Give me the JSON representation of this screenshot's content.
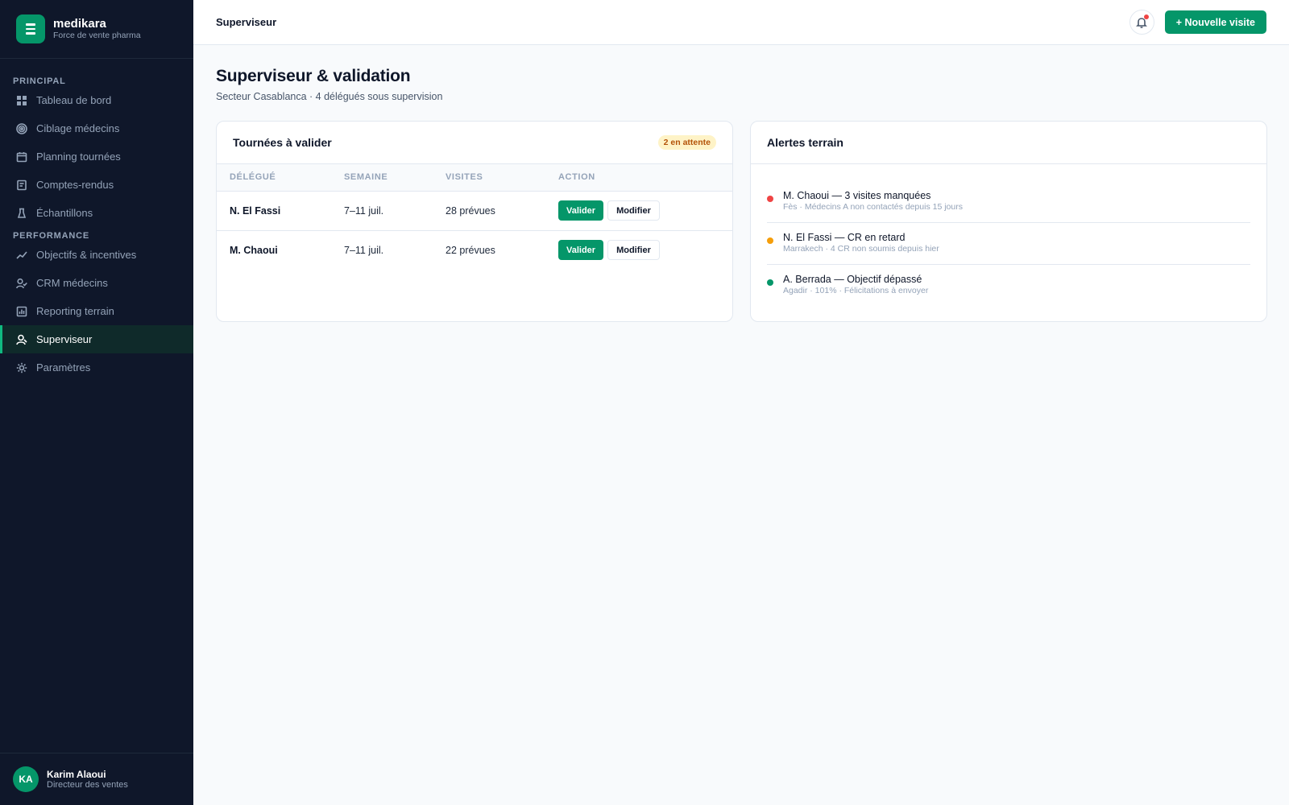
{
  "brand": {
    "name": "medikara",
    "subtitle": "Force de vente pharma"
  },
  "sidebar": {
    "sections": [
      {
        "label": "PRINCIPAL",
        "items": [
          {
            "label": "Tableau de bord",
            "icon": "grid-icon"
          },
          {
            "label": "Ciblage médecins",
            "icon": "target-icon"
          },
          {
            "label": "Planning tournées",
            "icon": "calendar-icon"
          },
          {
            "label": "Comptes-rendus",
            "icon": "document-icon"
          },
          {
            "label": "Échantillons",
            "icon": "flask-icon"
          }
        ]
      },
      {
        "label": "PERFORMANCE",
        "items": [
          {
            "label": "Objectifs & incentives",
            "icon": "trend-icon"
          },
          {
            "label": "CRM médecins",
            "icon": "user-check-icon"
          },
          {
            "label": "Reporting terrain",
            "icon": "chart-icon"
          },
          {
            "label": "Superviseur",
            "icon": "user-icon",
            "active": true
          },
          {
            "label": "Paramètres",
            "icon": "gear-icon"
          }
        ]
      }
    ],
    "active_color": "#10b981"
  },
  "user": {
    "initials": "KA",
    "name": "Karim Alaoui",
    "role": "Directeur des ventes"
  },
  "header": {
    "title": "Superviseur",
    "new_visit_label": "+ Nouvelle visite"
  },
  "page": {
    "title": "Superviseur & validation",
    "subtitle": "Secteur Casablanca · 4 délégués sous supervision"
  },
  "tours": {
    "title": "Tournées à valider",
    "badge": "2 en attente",
    "columns": [
      "DÉLÉGUÉ",
      "SEMAINE",
      "VISITES",
      "ACTION"
    ],
    "rows": [
      {
        "delegate": "N. El Fassi",
        "week": "7–11 juil.",
        "visits": "28 prévues",
        "validate": "Valider",
        "modify": "Modifier"
      },
      {
        "delegate": "M. Chaoui",
        "week": "7–11 juil.",
        "visits": "22 prévues",
        "validate": "Valider",
        "modify": "Modifier"
      }
    ]
  },
  "alerts": {
    "title": "Alertes terrain",
    "items": [
      {
        "title": "M. Chaoui — 3 visites manquées",
        "detail": "Fès · Médecins A non contactés depuis 15 jours",
        "color": "#ef4444"
      },
      {
        "title": "N. El Fassi — CR en retard",
        "detail": "Marrakech · 4 CR non soumis depuis hier",
        "color": "#f59e0b"
      },
      {
        "title": "A. Berrada — Objectif dépassé",
        "detail": "Agadir · 101% · Félicitations à envoyer",
        "color": "#059669"
      }
    ]
  }
}
